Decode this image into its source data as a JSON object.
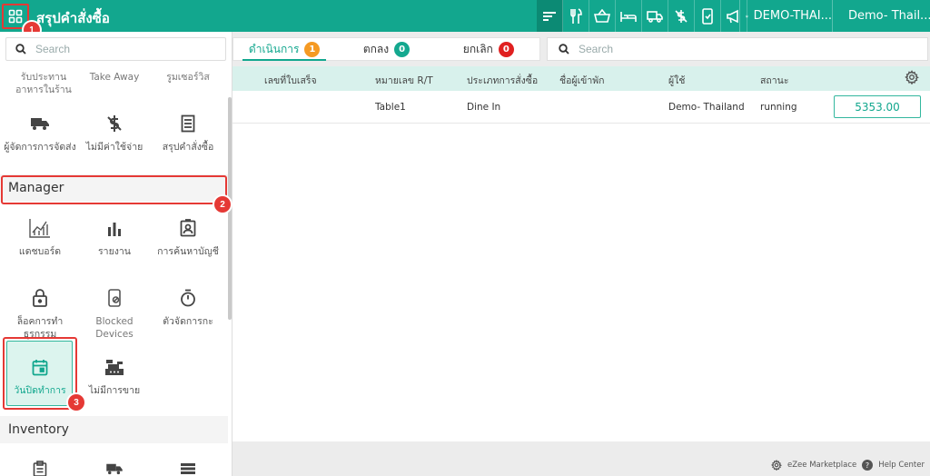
{
  "header": {
    "title": "สรุปคำสั่งซื้อ",
    "store_name": "DEMO-THAI...",
    "user_name": "Demo- Thail...",
    "icons": [
      "sort-icon",
      "utensils-icon",
      "basket-icon",
      "bed-icon",
      "truck-icon",
      "no-charge-icon",
      "mobile-order-icon",
      "megaphone-icon"
    ]
  },
  "sidebar": {
    "search_placeholder": "Search",
    "top_row": [
      "รับประทาน\nอาหารในร้าน",
      "Take Away",
      "รูมเซอร์วิส"
    ],
    "row2": [
      {
        "label": "ผู้จัดการการจัดส่ง",
        "icon": "truck-icon"
      },
      {
        "label": "ไม่มีค่าใช้จ่าย",
        "icon": "no-charge-icon"
      },
      {
        "label": "สรุปคำสั่งซื้อ",
        "icon": "receipt-icon"
      }
    ],
    "manager_title": "Manager",
    "manager_items": [
      {
        "label": "แดชบอร์ด",
        "icon": "dashboard-chart-icon"
      },
      {
        "label": "รายงาน",
        "icon": "bar-chart-icon"
      },
      {
        "label": "การค้นหาบัญชี",
        "icon": "account-search-icon"
      },
      {
        "label": "ล็อคการทำธุรกรรม",
        "icon": "lock-icon"
      },
      {
        "label": "Blocked Devices",
        "icon": "blocked-device-icon"
      },
      {
        "label": "ตัวจัดการกะ",
        "icon": "timer-icon"
      },
      {
        "label": "วันปิดทำการ",
        "icon": "calendar-icon"
      },
      {
        "label": "ไม่มีการขาย",
        "icon": "cash-register-icon"
      }
    ],
    "inventory_title": "Inventory"
  },
  "annotations": [
    "1",
    "2",
    "3"
  ],
  "tabs": [
    {
      "label": "ดำเนินการ",
      "count": "1",
      "color": "#f59a23"
    },
    {
      "label": "ตกลง",
      "count": "0",
      "color": "#14a88f"
    },
    {
      "label": "ยกเลิก",
      "count": "0",
      "color": "#e02020"
    }
  ],
  "main_search_placeholder": "Search",
  "table": {
    "columns": [
      "เลขที่ใบเสร็จ",
      "หมายเลข R/T",
      "ประเภทการสั่งซื้อ",
      "ชื่อผู้เข้าพัก",
      "ผู้ใช้",
      "สถานะ"
    ],
    "rows": [
      {
        "receipt": "",
        "rt": "Table1",
        "order_type": "Dine In",
        "guest": "",
        "user": "Demo- Thailand",
        "status": "running",
        "amount": "5353.00"
      }
    ]
  },
  "footer": {
    "marketplace": "eZee Marketplace",
    "help": "Help Center"
  },
  "colors": {
    "brand": "#12a78e",
    "highlight": "#e53935"
  }
}
